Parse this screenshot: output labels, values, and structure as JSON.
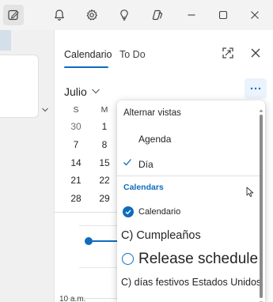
{
  "titlebar": {
    "icons": [
      "compose-edit-icon",
      "bell-icon",
      "gear-icon",
      "lightbulb-icon",
      "copilot-icon",
      "minimize-icon",
      "maximize-icon",
      "close-icon"
    ]
  },
  "pane": {
    "tabs": [
      {
        "label": "Calendario",
        "active": true
      },
      {
        "label": "To Do",
        "active": false
      }
    ]
  },
  "calendar": {
    "month": "Julio",
    "weekdays": [
      "S",
      "M"
    ],
    "weeks": [
      [
        "30",
        "1"
      ],
      [
        "7",
        "8"
      ],
      [
        "14",
        "15"
      ],
      [
        "21",
        "22"
      ],
      [
        "28",
        "29"
      ]
    ],
    "time_label": "10 a.m."
  },
  "menu": {
    "header": "Alternar vistas",
    "views": [
      {
        "label": "Agenda",
        "checked": false
      },
      {
        "label": "Día",
        "checked": true
      }
    ],
    "section_label": "Calendars",
    "calendars": [
      {
        "label": "Calendario",
        "state": "checked"
      },
      {
        "label": "C) Cumpleaños",
        "state": "none"
      },
      {
        "label": "Release schedule",
        "state": "unchecked"
      },
      {
        "label": "C) días festivos Estados Unidos",
        "state": "none"
      }
    ]
  },
  "colors": {
    "accent": "#0f6cbd",
    "more_button_bg": "#ebf3fc"
  }
}
